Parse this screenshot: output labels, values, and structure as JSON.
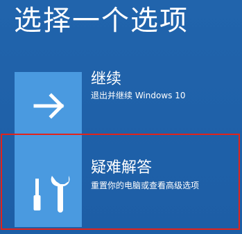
{
  "screen": {
    "title": "选择一个选项",
    "background_color": "#1e5fa6",
    "tile_color": "#4a9ae0",
    "highlight_color": "#e2231a"
  },
  "options": [
    {
      "id": "continue",
      "title": "继续",
      "description": "退出并继续 Windows 10",
      "icon": "arrow-right-icon"
    },
    {
      "id": "troubleshoot",
      "title": "疑难解答",
      "description": "重置你的电脑或查看高级选项",
      "icon": "tools-icon",
      "highlighted": true
    }
  ]
}
